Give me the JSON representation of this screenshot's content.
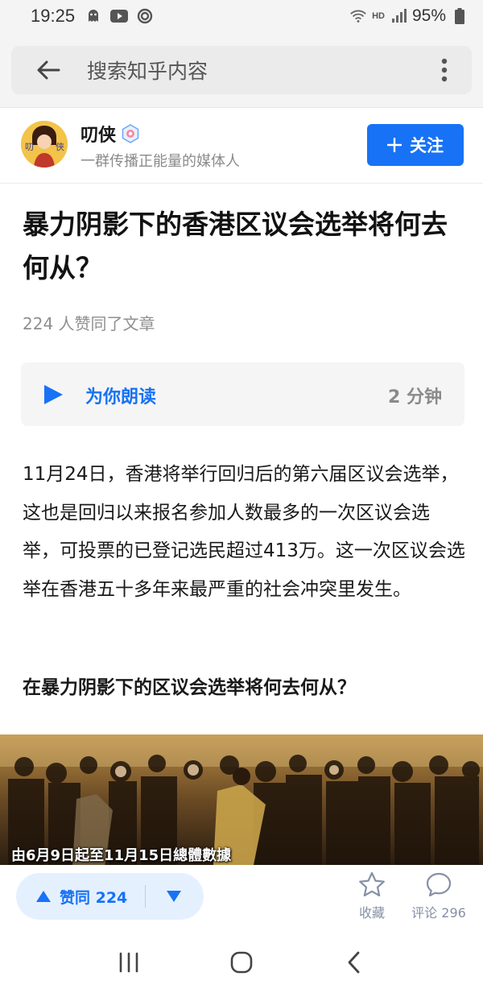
{
  "status_bar": {
    "time": "19:25",
    "network": "HD",
    "battery": "95%"
  },
  "search": {
    "placeholder": "搜索知乎内容"
  },
  "author": {
    "name": "叨侠",
    "description": "一群传播正能量的媒体人",
    "follow_label": "关注"
  },
  "article": {
    "title": "暴力阴影下的香港区议会选举将何去何从？",
    "likes_line": "224 人赞同了文章",
    "read_aloud_label": "为你朗读",
    "read_duration": "2 分钟",
    "paragraph": "11月24日，香港将举行回归后的第六届区议会选举，这也是回归以来报名参加人数最多的一次区议会选举，可投票的已登记选民超过413万。这一次区议会选举在香港五十多年来最严重的社会冲突里发生。",
    "subheading": "在暴力阴影下的区议会选举将何去何从？",
    "photo_caption": "由6月9日起至11月15日總體數據"
  },
  "actions": {
    "upvote_label": "赞同 224",
    "favorite_label": "收藏",
    "comment_label": "评论 296"
  },
  "colors": {
    "accent": "#1772f6",
    "upvote_bg": "#e5f0ff",
    "muted": "#8a8a8a"
  }
}
